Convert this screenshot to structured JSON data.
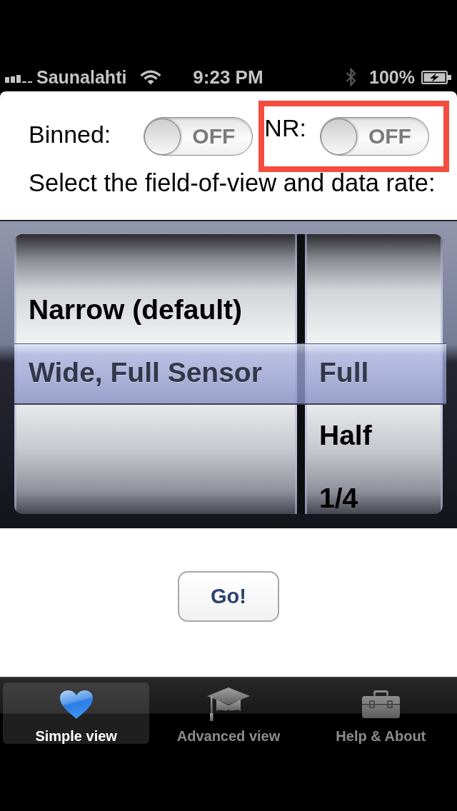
{
  "status_bar": {
    "carrier": "Saunalahti",
    "time": "9:23 PM",
    "battery": "100%"
  },
  "switches": [
    {
      "label": "Binned:",
      "state": "OFF",
      "on": false,
      "highlighted": false
    },
    {
      "label": "NR:",
      "state": "OFF",
      "on": false,
      "highlighted": true
    }
  ],
  "instruction": "Select the field-of-view and data rate:",
  "picker": {
    "columns": [
      {
        "options": [
          {
            "label": "Narrow (default)",
            "selected": false
          },
          {
            "label": "Wide, Full Sensor",
            "selected": true
          }
        ]
      },
      {
        "options": [
          {
            "label": "Full",
            "selected": true
          },
          {
            "label": "Half",
            "selected": false
          },
          {
            "label": "1/4",
            "selected": false
          }
        ]
      }
    ]
  },
  "go_button": {
    "label": "Go!"
  },
  "tab_bar": {
    "items": [
      {
        "label": "Simple view",
        "selected": true
      },
      {
        "label": "Advanced view",
        "selected": false
      },
      {
        "label": "Help & About",
        "selected": false
      }
    ]
  }
}
